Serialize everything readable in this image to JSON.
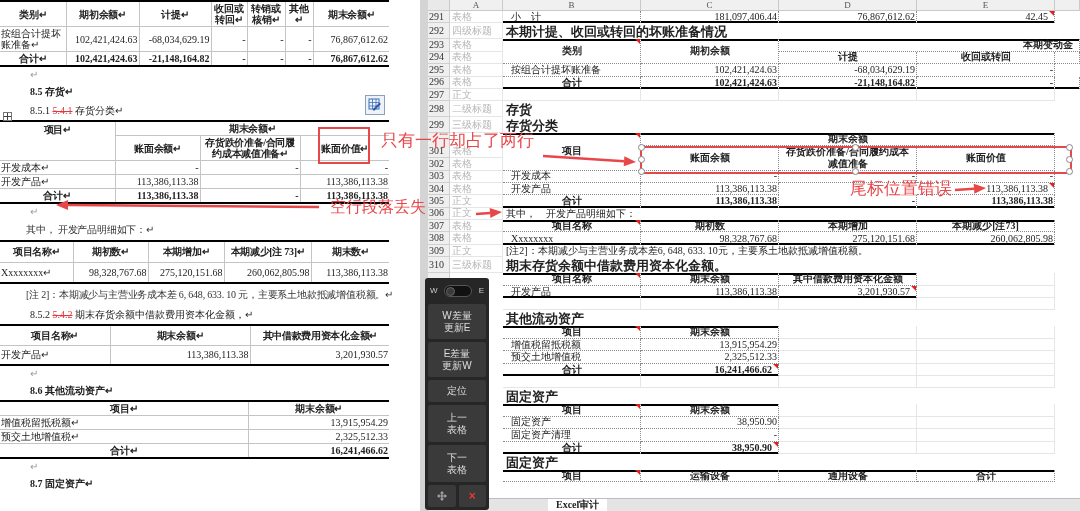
{
  "document": {
    "blocks": [
      {
        "kind": "table",
        "rows": [
          {
            "kind": "header",
            "cells": [
              {
                "text": "类别↵"
              },
              {
                "text": "期初余额↵"
              },
              {
                "text": "计提↵"
              },
              {
                "text": "收回或转回↵"
              },
              {
                "text": "转销或核销↵"
              },
              {
                "text": "其他↵"
              },
              {
                "text": "期末余额↵"
              }
            ]
          },
          {
            "kind": "body",
            "cells": [
              {
                "text": "按组合计提坏账准备↵"
              },
              {
                "text": "102,421,424.63"
              },
              {
                "text": "-68,034,629.19"
              },
              {
                "text": "-"
              },
              {
                "text": "-"
              },
              {
                "text": "-"
              },
              {
                "text": "76,867,612.62"
              }
            ]
          },
          {
            "kind": "total",
            "cells": [
              {
                "text": "合计↵"
              },
              {
                "text": "102,421,424.63"
              },
              {
                "text": "-21,148,164.82"
              },
              {
                "text": "-"
              },
              {
                "text": "-"
              },
              {
                "text": "-"
              },
              {
                "text": "76,867,612.62"
              }
            ]
          }
        ]
      },
      {
        "kind": "blank",
        "text": "↵"
      },
      {
        "kind": "heading",
        "number": "8.5",
        "text": "存货↵"
      },
      {
        "kind": "subheading",
        "number": "8.5.1",
        "deleted": "5.4.1",
        "text": "存货分类↵"
      },
      {
        "kind": "table",
        "rows": [
          {
            "kind": "header",
            "cells": [
              {
                "text": "项目↵"
              },
              {
                "text": "期末余额↵",
                "colspan": 3
              }
            ]
          },
          {
            "kind": "header",
            "cells": [
              {
                "kind": "merged_up"
              },
              {
                "text": "账面余额↵"
              },
              {
                "text": "存货跌价准备/合同履约成本减值准备↵"
              },
              {
                "text": "账面价值↵"
              }
            ]
          },
          {
            "kind": "body",
            "cells": [
              {
                "text": "开发成本↵"
              },
              {
                "text": "-"
              },
              {
                "text": "-"
              },
              {
                "text": "-"
              }
            ]
          },
          {
            "kind": "body",
            "cells": [
              {
                "text": "开发产品↵"
              },
              {
                "text": "113,386,113.38"
              },
              {
                "text": ""
              },
              {
                "text": "113,386,113.38"
              }
            ]
          },
          {
            "kind": "total",
            "cells": [
              {
                "text": "合计↵"
              },
              {
                "text": "113,386,113.38"
              },
              {
                "text": "-"
              },
              {
                "text": "113,386,113.38"
              }
            ]
          }
        ]
      },
      {
        "kind": "blank",
        "text": "↵"
      },
      {
        "kind": "para",
        "text": "其中， 开发产品明细如下：↵"
      },
      {
        "kind": "table",
        "rows": [
          {
            "kind": "header",
            "cells": [
              {
                "text": "项目名称↵"
              },
              {
                "text": "期初数↵"
              },
              {
                "text": "本期增加↵"
              },
              {
                "text": "本期减少[注 73]↵"
              },
              {
                "text": "期末数↵"
              }
            ]
          },
          {
            "kind": "body",
            "cells": [
              {
                "text": "Xxxxxxxx↵"
              },
              {
                "text": "98,328,767.68"
              },
              {
                "text": "275,120,151.68"
              },
              {
                "text": "260,062,805.98"
              },
              {
                "text": "113,386,113.38"
              }
            ]
          }
        ]
      },
      {
        "kind": "para",
        "text": "[注 2]：本期减少与主营业务成本差 6, 648, 633. 10 元，主要系土地款抵减增值税额。↵"
      },
      {
        "kind": "subheading",
        "number": "8.5.2",
        "deleted": "5.4.2",
        "text": "期末存货余额中借款费用资本化金额，↵"
      },
      {
        "kind": "table",
        "rows": [
          {
            "kind": "header",
            "cells": [
              {
                "text": "项目名称↵"
              },
              {
                "text": "期末余额↵"
              },
              {
                "text": "其中借款费用资本化金额↵"
              }
            ]
          },
          {
            "kind": "body",
            "cells": [
              {
                "text": "开发产品↵"
              },
              {
                "text": "113,386,113.38"
              },
              {
                "text": "3,201,930.57"
              }
            ]
          }
        ]
      },
      {
        "kind": "blank",
        "text": "↵"
      },
      {
        "kind": "heading",
        "number": "8.6",
        "text": "其他流动资产↵"
      },
      {
        "kind": "table",
        "rows": [
          {
            "kind": "header",
            "cells": [
              {
                "text": "项目↵"
              },
              {
                "text": "期末余额↵"
              }
            ]
          },
          {
            "kind": "body",
            "cells": [
              {
                "text": "增值税留抵税额↵"
              },
              {
                "text": "13,915,954.29"
              }
            ]
          },
          {
            "kind": "body",
            "cells": [
              {
                "text": "预交土地增值税↵"
              },
              {
                "text": "2,325,512.33"
              }
            ]
          },
          {
            "kind": "total",
            "cells": [
              {
                "text": "合计↵"
              },
              {
                "text": "16,241,466.62"
              }
            ]
          }
        ]
      },
      {
        "kind": "blank",
        "text": "↵"
      },
      {
        "kind": "heading",
        "number": "8.7",
        "text": "固定资产↵"
      }
    ]
  },
  "spreadsheet": {
    "columns": [
      "A",
      "B",
      "C",
      "D",
      "E"
    ],
    "rows": [
      {
        "num": "291",
        "label": "表格",
        "kind": "subtotal",
        "cells": [
          {
            "kind": "cell",
            "text": "小　计",
            "comment": false
          },
          {
            "kind": "cell",
            "text": "181,097,406.44",
            "comment": false
          },
          {
            "kind": "cell",
            "text": "76,867,612.62",
            "comment": false
          },
          {
            "kind": "cell",
            "text": "42.45",
            "comment": true
          }
        ]
      },
      {
        "num": "292",
        "label": "四级标题",
        "kind": "heading",
        "cells": [
          {
            "kind": "cell",
            "text": "本期计提、收回或转回的坏账准备情况"
          }
        ]
      },
      {
        "num": "293",
        "label": "表格",
        "kind": "header",
        "cells": [
          {
            "kind": "cell",
            "text": "类别",
            "comment": true
          },
          {
            "kind": "cell",
            "text": "期初余额",
            "comment": false
          },
          {
            "kind": "cell",
            "text": "本期变动金",
            "comment": false
          },
          {
            "kind": "merged_left"
          },
          {
            "kind": "merged_left"
          }
        ]
      },
      {
        "num": "294",
        "label": "表格",
        "kind": "header2",
        "cells": [
          {
            "kind": "merged_up"
          },
          {
            "kind": "merged_up"
          },
          {
            "kind": "cell",
            "text": "计提",
            "comment": false
          },
          {
            "kind": "cell",
            "text": "收回或转回",
            "comment": false
          },
          {
            "kind": "empty"
          }
        ]
      },
      {
        "num": "295",
        "label": "表格",
        "kind": "body",
        "cells": [
          {
            "kind": "cell",
            "text": "按组合计提坏账准备",
            "comment": false
          },
          {
            "kind": "cell",
            "text": "102,421,424.63",
            "comment": false
          },
          {
            "kind": "cell",
            "text": "-68,034,629.19",
            "comment": false
          },
          {
            "kind": "cell",
            "text": "-",
            "comment": false
          },
          {
            "kind": "empty"
          }
        ]
      },
      {
        "num": "296",
        "label": "表格",
        "kind": "total",
        "cells": [
          {
            "kind": "cell",
            "text": "合计",
            "comment": false
          },
          {
            "kind": "cell",
            "text": "102,421,424.63",
            "comment": false
          },
          {
            "kind": "cell",
            "text": "-21,148,164.82",
            "comment": false
          },
          {
            "kind": "cell",
            "text": "-",
            "comment": false
          },
          {
            "kind": "empty"
          }
        ]
      },
      {
        "num": "297",
        "label": "正文",
        "kind": "blank"
      },
      {
        "num": "298",
        "label": "二级标题",
        "kind": "heading",
        "cells": [
          {
            "kind": "cell",
            "text": "存货"
          }
        ]
      },
      {
        "num": "299",
        "label": "三级标题",
        "kind": "heading",
        "cells": [
          {
            "kind": "cell",
            "text": "存货分类"
          }
        ]
      },
      {
        "kind": "header",
        "cells": [
          {
            "kind": "cell",
            "text": "项目",
            "comment": true
          },
          {
            "kind": "cell",
            "text": "期末余额",
            "comment": false
          },
          {
            "kind": "merged_left"
          },
          {
            "kind": "merged_left"
          }
        ]
      },
      {
        "num": "301",
        "label": "表格",
        "kind": "header2",
        "cells": [
          {
            "kind": "merged_up"
          },
          {
            "kind": "cell",
            "text": "账面余额",
            "comment": false
          },
          {
            "kind": "cell",
            "text": "存货跌价准备/合同履约成本减值准备",
            "comment": false
          },
          {
            "kind": "cell",
            "text": "账面价值",
            "comment": false
          }
        ]
      },
      {
        "num": "302",
        "label": "表格",
        "kind": "header2",
        "cells": [
          {
            "kind": "merged_up"
          },
          {
            "kind": "merged_up"
          },
          {
            "kind": "merged_up"
          },
          {
            "kind": "merged_up"
          }
        ]
      },
      {
        "num": "303",
        "label": "表格",
        "kind": "body",
        "cells": [
          {
            "kind": "cell",
            "text": "开发成本",
            "comment": false
          },
          {
            "kind": "cell",
            "text": "-",
            "comment": false
          },
          {
            "kind": "cell",
            "text": "-",
            "comment": false
          },
          {
            "kind": "cell",
            "text": "-",
            "comment": false
          }
        ]
      },
      {
        "num": "304",
        "label": "表格",
        "kind": "body",
        "cells": [
          {
            "kind": "cell",
            "text": "开发产品",
            "comment": false
          },
          {
            "kind": "cell",
            "text": "113,386,113.38",
            "comment": false
          },
          {
            "kind": "empty"
          },
          {
            "kind": "cell",
            "text": "113,386,113.38",
            "comment": true
          }
        ]
      },
      {
        "num": "305",
        "label": "正文",
        "kind": "total",
        "cells": [
          {
            "kind": "cell",
            "text": "合计",
            "comment": false
          },
          {
            "kind": "cell",
            "text": "113,386,113.38",
            "comment": false
          },
          {
            "kind": "cell",
            "text": "-",
            "comment": false
          },
          {
            "kind": "cell",
            "text": "113,386,113.38",
            "comment": false
          }
        ]
      },
      {
        "num": "306",
        "label": "正文",
        "kind": "text",
        "cells": [
          {
            "kind": "cell",
            "text": "其中，　开发产品明细如下："
          }
        ]
      },
      {
        "num": "307",
        "label": "表格",
        "kind": "header",
        "cells": [
          {
            "kind": "cell",
            "text": "项目名称",
            "comment": true
          },
          {
            "kind": "cell",
            "text": "期初数",
            "comment": false
          },
          {
            "kind": "cell",
            "text": "本期增加",
            "comment": false
          },
          {
            "kind": "cell",
            "text": "本期减少[注73]",
            "comment": false
          }
        ]
      },
      {
        "num": "308",
        "label": "表格",
        "kind": "subtotal",
        "cells": [
          {
            "kind": "cell",
            "text": "Xxxxxxxx",
            "comment": false
          },
          {
            "kind": "cell",
            "text": "98,328,767.68",
            "comment": false
          },
          {
            "kind": "cell",
            "text": "275,120,151.68",
            "comment": false
          },
          {
            "kind": "cell",
            "text": "260,062,805.98",
            "comment": false
          }
        ]
      },
      {
        "num": "309",
        "label": "正文",
        "kind": "text",
        "cells": [
          {
            "kind": "cell",
            "text": "[注2]：本期减少与主营业务成本差6, 648, 633. 10元，主要系土地款抵减增值税额。"
          }
        ]
      },
      {
        "num": "310",
        "label": "三级标题",
        "kind": "heading",
        "cells": [
          {
            "kind": "cell",
            "text": "期末存货余额中借款费用资本化金额。"
          }
        ]
      },
      {
        "kind": "header",
        "cells": [
          {
            "kind": "cell",
            "text": "项目名称",
            "comment": true
          },
          {
            "kind": "cell",
            "text": "期末余额",
            "comment": false
          },
          {
            "kind": "cell",
            "text": "其中借款费用资本化金额",
            "comment": false
          }
        ]
      },
      {
        "kind": "subtotal",
        "cells": [
          {
            "kind": "cell",
            "text": "开发产品",
            "comment": false
          },
          {
            "kind": "cell",
            "text": "113,386,113.38",
            "comment": false
          },
          {
            "kind": "cell",
            "text": "3,201,930.57",
            "comment": true
          }
        ]
      },
      {
        "kind": "blank"
      },
      {
        "kind": "heading",
        "cells": [
          {
            "kind": "cell",
            "text": "其他流动资产"
          }
        ]
      },
      {
        "kind": "header",
        "cells": [
          {
            "kind": "cell",
            "text": "项目",
            "comment": true
          },
          {
            "kind": "cell",
            "text": "期末余额",
            "comment": false
          }
        ]
      },
      {
        "kind": "body",
        "cells": [
          {
            "kind": "cell",
            "text": "增值税留抵税额",
            "comment": false
          },
          {
            "kind": "cell",
            "text": "13,915,954.29",
            "comment": false
          }
        ]
      },
      {
        "kind": "body",
        "cells": [
          {
            "kind": "cell",
            "text": "预交土地增值税",
            "comment": false
          },
          {
            "kind": "cell",
            "text": "2,325,512.33",
            "comment": false
          }
        ]
      },
      {
        "kind": "total",
        "cells": [
          {
            "kind": "cell",
            "text": "合计",
            "comment": false
          },
          {
            "kind": "cell",
            "text": "16,241,466.62",
            "comment": true
          }
        ]
      },
      {
        "kind": "blank"
      },
      {
        "kind": "heading",
        "cells": [
          {
            "kind": "cell",
            "text": "固定资产"
          }
        ]
      },
      {
        "kind": "header",
        "cells": [
          {
            "kind": "cell",
            "text": "项目",
            "comment": true
          },
          {
            "kind": "cell",
            "text": "期末余额",
            "comment": false
          }
        ]
      },
      {
        "kind": "body",
        "cells": [
          {
            "kind": "cell",
            "text": "固定资产",
            "comment": false
          },
          {
            "kind": "cell",
            "text": "38,950.90",
            "comment": false
          }
        ]
      },
      {
        "kind": "body",
        "cells": [
          {
            "kind": "cell",
            "text": "固定资产清理",
            "comment": false
          },
          {
            "kind": "cell",
            "text": "-",
            "comment": false
          }
        ]
      },
      {
        "kind": "total",
        "cells": [
          {
            "kind": "cell",
            "text": "合计",
            "comment": false
          },
          {
            "kind": "cell",
            "text": "38,950.90",
            "comment": true
          }
        ]
      },
      {
        "kind": "heading",
        "cells": [
          {
            "kind": "cell",
            "text": "固定资产"
          }
        ]
      },
      {
        "kind": "header",
        "cells": [
          {
            "kind": "cell",
            "text": "项目",
            "comment": true
          },
          {
            "kind": "cell",
            "text": "运输设备",
            "comment": false
          },
          {
            "kind": "cell",
            "text": "通用设备",
            "comment": false
          },
          {
            "kind": "cell",
            "text": "合计",
            "comment": false
          }
        ]
      },
      {
        "kind": "body",
        "cells": [
          {
            "kind": "empty"
          },
          {
            "kind": "empty"
          },
          {
            "kind": "empty"
          },
          {
            "kind": "empty"
          }
        ]
      }
    ],
    "sheet_tabs": [
      {
        "label": "Excel审计",
        "selected": true
      }
    ]
  },
  "toolbar": {
    "switch": {
      "left": "W",
      "right": "E",
      "on": false
    },
    "buttons": [
      {
        "label": "W差量更新E"
      },
      {
        "label": "E差量更新W"
      },
      {
        "label": "定位"
      },
      {
        "label": "上一表格"
      },
      {
        "label": "下一表格"
      }
    ],
    "close": "×"
  },
  "annotations": [
    {
      "text": "只有一行却占了两行"
    },
    {
      "text": "尾标位置错误"
    },
    {
      "text": "空行段落丢失"
    }
  ]
}
